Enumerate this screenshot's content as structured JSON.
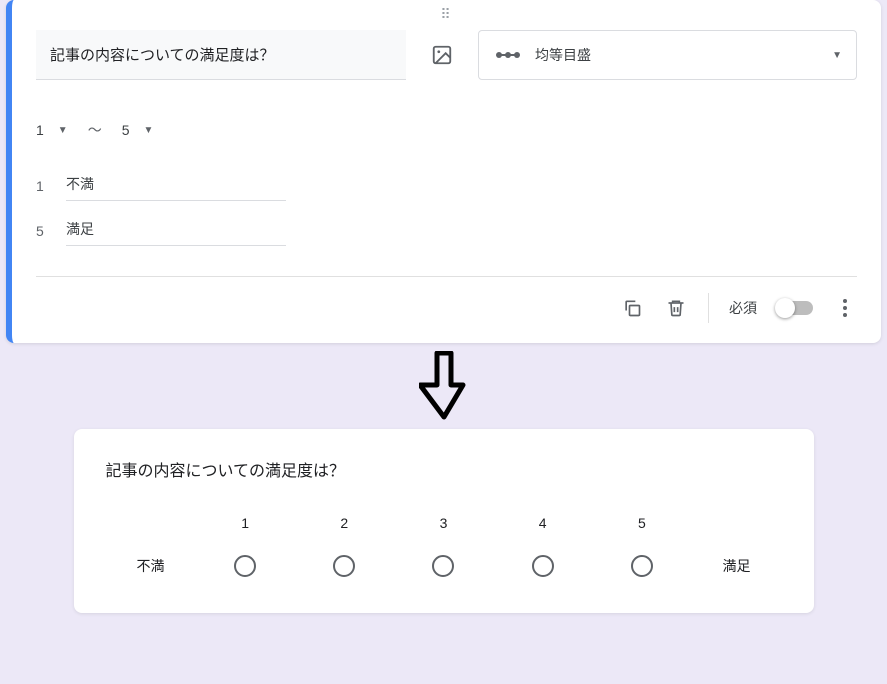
{
  "editor": {
    "question": "記事の内容についての満足度は？",
    "type_label": "均等目盛",
    "range_from": "1",
    "range_to": "5",
    "range_sep": "～",
    "label_low_idx": "1",
    "label_low": "不満",
    "label_high_idx": "5",
    "label_high": "満足",
    "required_label": "必須"
  },
  "preview": {
    "question": "記事の内容についての満足度は？",
    "label_low": "不満",
    "label_high": "満足",
    "nums": [
      "1",
      "2",
      "3",
      "4",
      "5"
    ]
  }
}
